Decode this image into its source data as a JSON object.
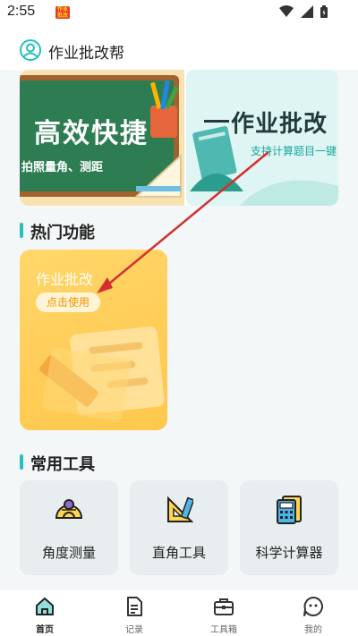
{
  "status": {
    "time": "2:55",
    "app_icon_text": "小学作业批改"
  },
  "header": {
    "title": "作业批改帮",
    "avatar_icon": "user-avatar-icon"
  },
  "banner": {
    "left": {
      "title": "高效快捷",
      "subtitle": "拍照量角、测距"
    },
    "right": {
      "title": "作业批改",
      "subtitle": "支持计算题目一键"
    }
  },
  "hot": {
    "section_title": "热门功能",
    "feature": {
      "title": "作业批改",
      "button": "点击使用"
    }
  },
  "tools": {
    "section_title": "常用工具",
    "items": [
      {
        "label": "角度测量",
        "icon": "protractor-icon"
      },
      {
        "label": "直角工具",
        "icon": "set-square-icon"
      },
      {
        "label": "科学计算器",
        "icon": "calculator-icon"
      }
    ]
  },
  "nav": {
    "items": [
      {
        "label": "首页",
        "icon": "home-icon",
        "active": true
      },
      {
        "label": "记录",
        "icon": "document-icon",
        "active": false
      },
      {
        "label": "工具箱",
        "icon": "toolbox-icon",
        "active": false
      },
      {
        "label": "我的",
        "icon": "smiley-icon",
        "active": false
      }
    ]
  },
  "colors": {
    "accent": "#22c1c0",
    "feature_card": "#ffcd58",
    "annotation_arrow": "#d32f2f",
    "nav_active": "#222222"
  }
}
